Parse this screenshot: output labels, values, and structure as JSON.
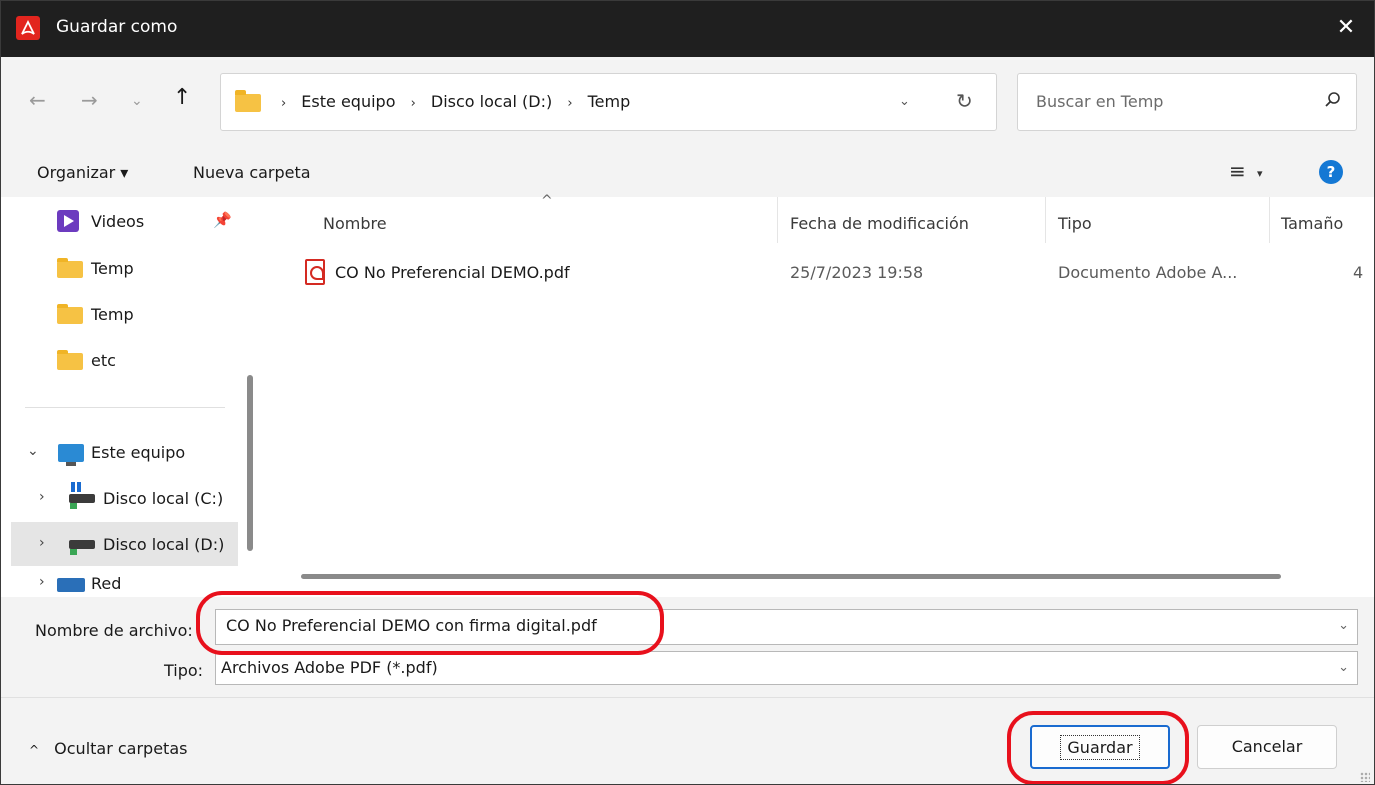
{
  "window": {
    "title": "Guardar como",
    "close_glyph": "✕"
  },
  "nav": {
    "back_glyph": "←",
    "forward_glyph": "→",
    "recent_glyph": "⌄",
    "up_glyph": "↑",
    "breadcrumbs": [
      "Este equipo",
      "Disco local (D:)",
      "Temp"
    ],
    "crumb_sep": "›",
    "dropdown_glyph": "⌄",
    "refresh_glyph": "↻"
  },
  "search": {
    "placeholder": "Buscar en Temp"
  },
  "toolbar": {
    "organize_label": "Organizar ▾",
    "new_folder_label": "Nueva carpeta",
    "view_glyph": "≡",
    "view_caret": "▾",
    "help_glyph": "?"
  },
  "sidebar": {
    "items": [
      {
        "label": "Videos",
        "icon": "videos-icon",
        "pinned": true
      },
      {
        "label": "Temp",
        "icon": "folder-icon"
      },
      {
        "label": "Temp",
        "icon": "folder-icon"
      },
      {
        "label": "etc",
        "icon": "folder-icon"
      },
      {
        "label": "Este equipo",
        "icon": "pc-icon",
        "expanded": true
      },
      {
        "label": "Disco local (C:)",
        "icon": "drive-icon"
      },
      {
        "label": "Disco local (D:)",
        "icon": "drive-icon",
        "selected": true
      },
      {
        "label": "Red",
        "icon": "network-icon"
      }
    ],
    "pin_glyph": "📌",
    "chevron_expanded": "⌄",
    "chevron_collapsed": "›"
  },
  "columns": {
    "name": "Nombre",
    "date": "Fecha de modificación",
    "type": "Tipo",
    "size": "Tamaño",
    "sort_glyph": "^"
  },
  "files": [
    {
      "name": "CO No Preferencial DEMO.pdf",
      "date": "25/7/2023 19:58",
      "type": "Documento Adobe A...",
      "size": "4"
    }
  ],
  "form": {
    "filename_label": "Nombre de archivo:",
    "filename_value": "CO No Preferencial DEMO con firma digital.pdf",
    "type_label": "Tipo:",
    "type_value": "Archivos Adobe PDF (*.pdf)",
    "caret": "⌄"
  },
  "footer": {
    "hide_folders_label": "Ocultar carpetas",
    "hide_caret": "^",
    "save_label": "Guardar",
    "cancel_label": "Cancelar"
  },
  "colors": {
    "annotation": "#e8101c",
    "accent": "#1a6bd0",
    "titlebar": "#1f1f1f"
  }
}
